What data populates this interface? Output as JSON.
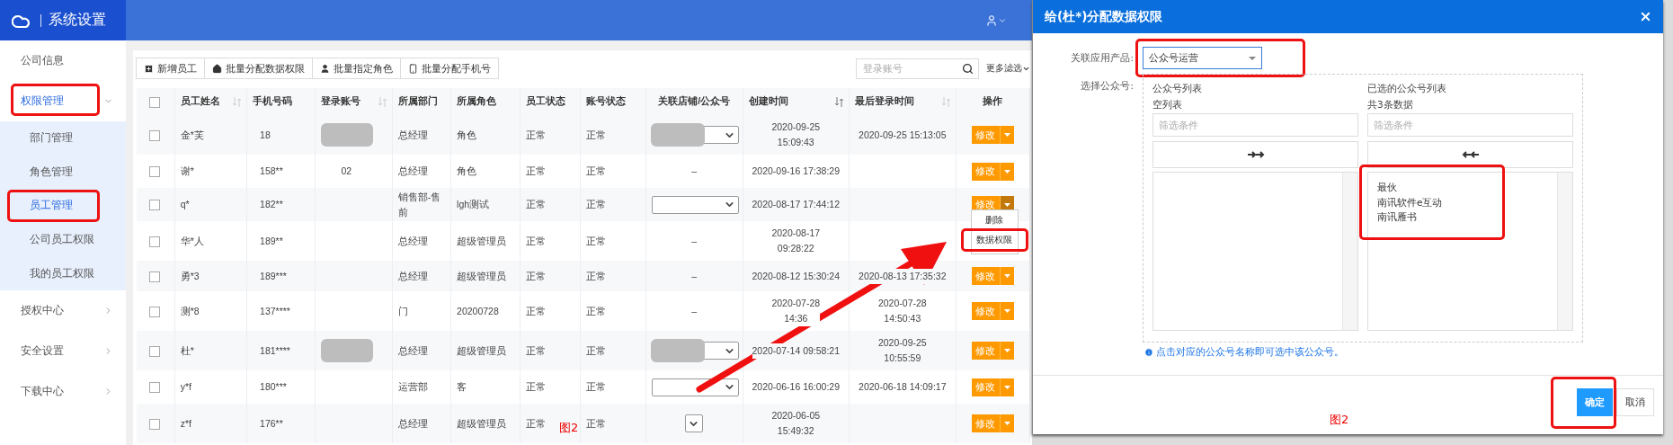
{
  "app": {
    "title": "系统设置"
  },
  "sidebar": {
    "items": [
      {
        "label": "公司信息",
        "has_children": false,
        "highlighted": false
      },
      {
        "label": "权限管理",
        "expanded": true,
        "has_children": true,
        "highlighted": true,
        "children": [
          {
            "label": "部门管理",
            "selected": false,
            "highlighted": false
          },
          {
            "label": "角色管理",
            "selected": false,
            "highlighted": false
          },
          {
            "label": "员工管理",
            "selected": true,
            "highlighted": true
          },
          {
            "label": "公司员工权限",
            "selected": false,
            "highlighted": false
          },
          {
            "label": "我的员工权限",
            "selected": false,
            "highlighted": false
          }
        ]
      },
      {
        "label": "授权中心",
        "expanded": false,
        "has_children": true,
        "highlighted": false
      },
      {
        "label": "安全设置",
        "expanded": false,
        "has_children": true,
        "highlighted": false
      },
      {
        "label": "下载中心",
        "expanded": false,
        "has_children": true,
        "highlighted": false
      }
    ]
  },
  "toolbar": {
    "buttons": [
      {
        "label": "新增员工",
        "kind": "add"
      },
      {
        "label": "批量分配数据权限",
        "kind": "home"
      },
      {
        "label": "批量指定角色",
        "kind": "user"
      },
      {
        "label": "批量分配手机号",
        "kind": "mobile"
      }
    ],
    "search": {
      "placeholder": "登录账号"
    },
    "filter": "更多滤选"
  },
  "table": {
    "select_all": {
      "checked": false
    },
    "columns": [
      {
        "label": "员工姓名",
        "sortable": true
      },
      {
        "label": "手机号码",
        "sortable": false
      },
      {
        "label": "登录账号",
        "sortable": true
      },
      {
        "label": "所属部门",
        "sortable": false
      },
      {
        "label": "所属角色",
        "sortable": false
      },
      {
        "label": "员工状态",
        "sortable": false
      },
      {
        "label": "账号状态",
        "sortable": false
      },
      {
        "label": "关联店铺/公众号",
        "sortable": false
      },
      {
        "label": "创建时间",
        "sortable": true
      },
      {
        "label": "最后登录时间",
        "sortable": true
      },
      {
        "label": "操作",
        "sortable": false
      }
    ],
    "rows": [
      {
        "checked": false,
        "name": "金*芙",
        "phone": "18",
        "account_masked": true,
        "department": "总经理",
        "role": "角色",
        "employee_status": "正常",
        "account_status": "正常",
        "store": {
          "kind": "select",
          "masked": true
        },
        "created": "2020-09-25\n15:09:43",
        "last_login": "2020-09-25 15:13:05",
        "action": {
          "label": "修改",
          "expanded": false
        }
      },
      {
        "checked": false,
        "name": "谢*",
        "phone": "158**",
        "account": "02",
        "account_masked": false,
        "department": "总经理",
        "role": "角色",
        "employee_status": "正常",
        "account_status": "正常",
        "store": {
          "kind": "dash",
          "text": "–"
        },
        "created": "2020-09-16 17:38:29",
        "action": {
          "label": "修改",
          "expanded": false
        }
      },
      {
        "checked": false,
        "name": "q*",
        "phone": "182**",
        "account_masked": false,
        "department": "销售部-售前",
        "role": "lgh测试",
        "employee_status": "正常",
        "account_status": "正常",
        "store": {
          "kind": "select",
          "masked": false
        },
        "created": "2020-08-17 17:44:12",
        "action": {
          "label": "修改",
          "expanded": true,
          "menu": [
            {
              "label": "删除",
              "highlighted": false
            },
            {
              "label": "数据权限",
              "highlighted": true
            }
          ]
        }
      },
      {
        "checked": false,
        "name": "华*人",
        "phone": "189**",
        "account_masked": false,
        "department": "总经理",
        "role": "超级管理员",
        "employee_status": "正常",
        "account_status": "正常",
        "store": {
          "kind": "dash",
          "text": "–"
        },
        "created": "2020-08-17\n09:28:22"
      },
      {
        "checked": false,
        "name": "勇*3",
        "phone": "189***",
        "account_masked": false,
        "department": "总经理",
        "role": "超级管理员",
        "employee_status": "正常",
        "account_status": "正常",
        "store": {
          "kind": "dash",
          "text": "–"
        },
        "created": "2020-08-12 15:30:24",
        "last_login": "2020-08-13 17:35:32",
        "action": {
          "label": "修改",
          "expanded": false
        }
      },
      {
        "checked": false,
        "name": "测*8",
        "phone": "137****",
        "account_masked": false,
        "department": "门",
        "role": "20200728",
        "employee_status": "正常",
        "account_status": "正常",
        "store": {
          "kind": "dash",
          "text": "–"
        },
        "created": "2020-07-28\n14:36",
        "last_login": "2020-07-28\n14:50:43",
        "action": {
          "label": "修改",
          "expanded": false
        }
      },
      {
        "checked": false,
        "name": "杜*",
        "phone": "181****",
        "account_masked": true,
        "department": "总经理",
        "role": "超级管理员",
        "employee_status": "正常",
        "account_status": "正常",
        "store": {
          "kind": "select",
          "masked": true
        },
        "created": "2020-07-14 09:58:21",
        "last_login": "2020-09-25\n10:55:59",
        "action": {
          "label": "修改",
          "expanded": false
        }
      },
      {
        "checked": false,
        "name": "y*f",
        "phone": "180***",
        "account_masked": false,
        "department": "运营部",
        "role": "客",
        "employee_status": "正常",
        "account_status": "正常",
        "store": {
          "kind": "select",
          "masked": false
        },
        "created": "2020-06-16 16:00:29",
        "last_login": "2020-06-18 14:09:17",
        "action": {
          "label": "修改",
          "expanded": false
        }
      },
      {
        "checked": false,
        "name": "z*f",
        "phone": "176**",
        "account_masked": false,
        "department": "总经理",
        "role": "超级管理员",
        "employee_status": "正常",
        "account_status": "正常",
        "store": {
          "kind": "caret"
        },
        "created": "2020-06-05\n15:49:32",
        "action": {
          "label": "修改",
          "expanded": false
        }
      }
    ]
  },
  "caption": "图2",
  "dialog": {
    "title": "给(杜*)分配数据权限",
    "product": {
      "label": "关联应用产品:",
      "value": "公众号运营",
      "highlighted": true
    },
    "picker_label": "选择公众号:",
    "source": {
      "title": "公众号列表",
      "count": "空列表",
      "filter_placeholder": "筛选条件",
      "highlighted": false
    },
    "target": {
      "title": "已选的公众号列表",
      "count": "共3条数据",
      "filter_placeholder": "筛选条件",
      "highlighted": true,
      "items": [
        "最伙",
        "南讯软件e互动",
        "南讯雁书"
      ]
    },
    "note": "点击对应的公众号名称即可选中该公众号。",
    "buttons": [
      {
        "label": "确定",
        "kind": "primary",
        "highlighted": true
      },
      {
        "label": "取消",
        "kind": "default",
        "highlighted": false
      }
    ],
    "caption": "图2"
  }
}
